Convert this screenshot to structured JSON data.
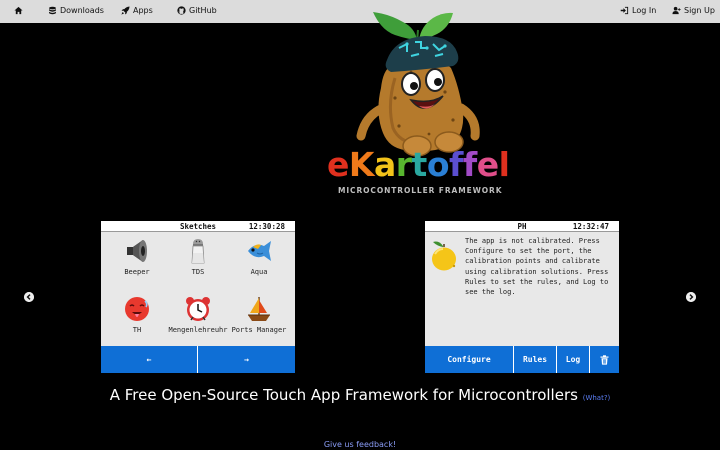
{
  "nav": {
    "home_icon": "home-icon",
    "downloads": "Downloads",
    "apps": "Apps",
    "github": "GitHub",
    "login": "Log In",
    "signup": "Sign Up"
  },
  "logo": {
    "letters": [
      "e",
      "K",
      "a",
      "r",
      "t",
      "o",
      "f",
      "f",
      "e",
      "l"
    ],
    "letter_colors": [
      "#e0301e",
      "#f07a1a",
      "#f2c21a",
      "#58b62f",
      "#2aa8a0",
      "#2a7fd4",
      "#5b4fd0",
      "#a24bc7",
      "#e04e8a",
      "#e0301e"
    ],
    "subtitle": "MICROCONTROLLER FRAMEWORK"
  },
  "sketches": {
    "title": "Sketches",
    "clock": "12:30:28",
    "apps": [
      {
        "label": "Beeper",
        "icon": "speaker-icon"
      },
      {
        "label": "TDS",
        "icon": "salt-shaker-icon"
      },
      {
        "label": "Aqua",
        "icon": "fish-icon"
      },
      {
        "label": "TH",
        "icon": "hot-face-icon"
      },
      {
        "label": "Mengenlehreuhr",
        "icon": "alarm-clock-icon"
      },
      {
        "label": "Ports Manager",
        "icon": "sailboat-icon"
      }
    ],
    "prev": "←",
    "next": "→"
  },
  "ph": {
    "title": "PH",
    "clock": "12:32:47",
    "icon": "lemon-icon",
    "message": "The app is not calibrated. Press Configure to set the port, the calibration points and calibrate using calibration solutions. Press Rules to set the rules, and Log to see the log.",
    "btn_configure": "Configure",
    "btn_rules": "Rules",
    "btn_log": "Log",
    "btn_delete_icon": "trash-icon"
  },
  "carousel": {
    "prev_icon": "chevron-left-icon",
    "next_icon": "chevron-right-icon"
  },
  "tagline": "A Free Open-Source Touch App Framework for Microcontrollers",
  "tagline_link": "(What?)",
  "feedback": "Give us feedback!"
}
